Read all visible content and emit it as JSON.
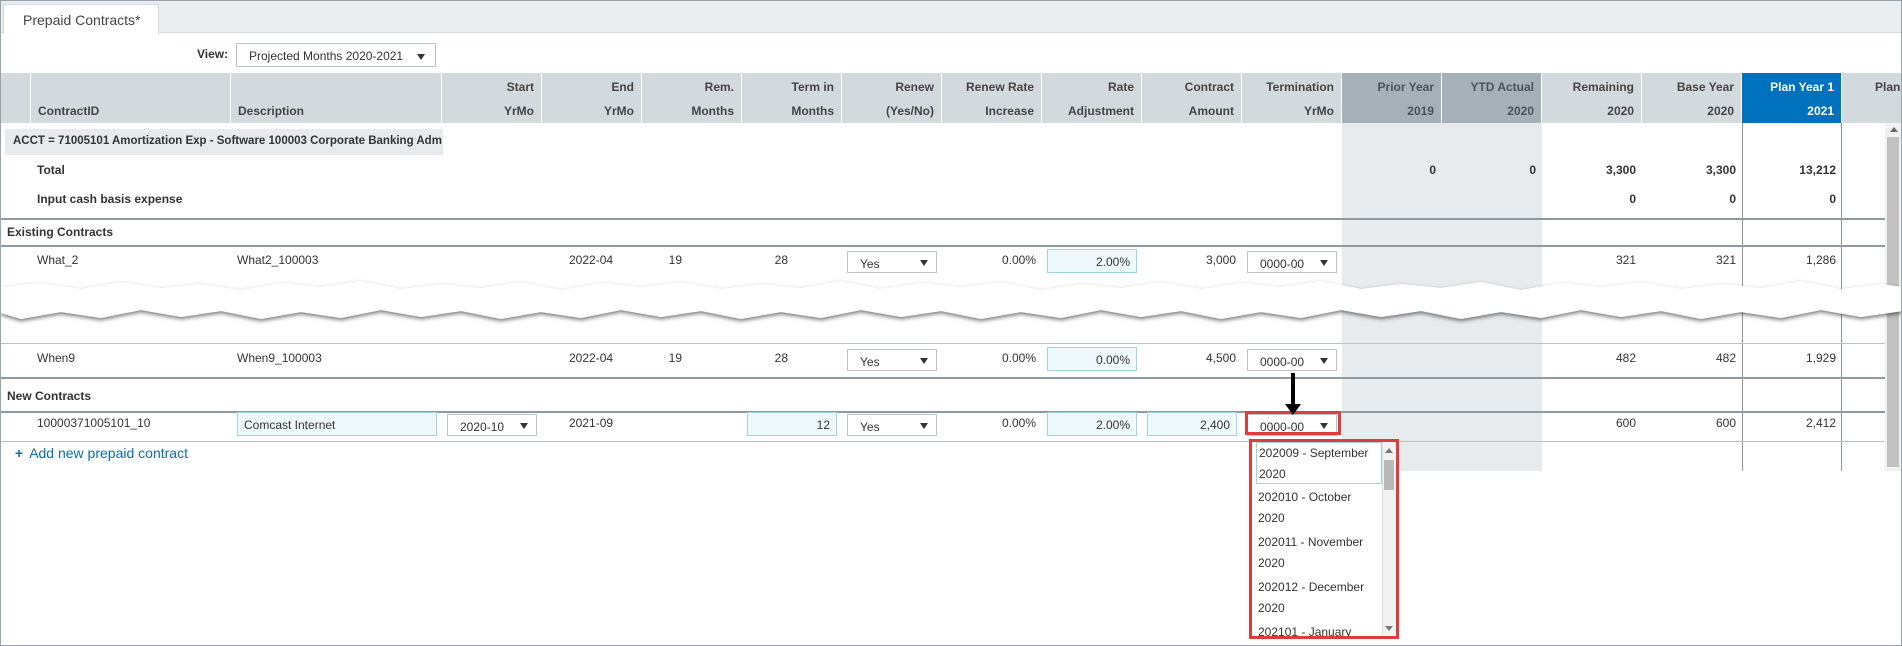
{
  "tab": {
    "label": "Prepaid Contracts*"
  },
  "view": {
    "label": "View:",
    "value": "Projected  Months 2020-2021"
  },
  "columns": [
    {
      "l1": "",
      "l2": "ContractID"
    },
    {
      "l1": "",
      "l2": "Description"
    },
    {
      "l1": "Start",
      "l2": "YrMo"
    },
    {
      "l1": "End",
      "l2": "YrMo"
    },
    {
      "l1": "Rem.",
      "l2": "Months"
    },
    {
      "l1": "Term in",
      "l2": "Months"
    },
    {
      "l1": "Renew",
      "l2": "(Yes/No)"
    },
    {
      "l1": "Renew Rate",
      "l2": "Increase"
    },
    {
      "l1": "Rate",
      "l2": "Adjustment"
    },
    {
      "l1": "Contract",
      "l2": "Amount"
    },
    {
      "l1": "Termination",
      "l2": "YrMo"
    },
    {
      "l1": "Prior Year",
      "l2": "2019"
    },
    {
      "l1": "YTD Actual",
      "l2": "2020"
    },
    {
      "l1": "Remaining",
      "l2": "2020"
    },
    {
      "l1": "Base Year",
      "l2": "2020"
    },
    {
      "l1": "Plan Year 1",
      "l2": "2021"
    },
    {
      "l1": "Plan",
      "l2": ""
    }
  ],
  "acct": "ACCT = 71005101 Amortization Exp - Software 100003 Corporate Banking Adm",
  "total": {
    "label": "Total",
    "prior": "0",
    "ytd": "0",
    "remaining": "3,300",
    "base": "3,300",
    "plan1": "13,212"
  },
  "input_cash": {
    "label": "Input cash basis expense",
    "remaining": "0",
    "base": "0",
    "plan1": "0"
  },
  "existing": {
    "label": "Existing Contracts",
    "rows": [
      {
        "id": "What_2",
        "desc": "What2_100003",
        "end": "2022-04",
        "rem": "19",
        "term": "28",
        "renew": "Yes",
        "renew_rate": "0.00%",
        "rate_adj": "2.00%",
        "amount": "3,000",
        "term_yrmo": "0000-00",
        "remaining": "321",
        "base": "321",
        "plan1": "1,286"
      },
      {
        "id": "When9",
        "desc": "When9_100003",
        "end": "2022-04",
        "rem": "19",
        "term": "28",
        "renew": "Yes",
        "renew_rate": "0.00%",
        "rate_adj": "0.00%",
        "amount": "4,500",
        "term_yrmo": "0000-00",
        "remaining": "482",
        "base": "482",
        "plan1": "1,929"
      }
    ]
  },
  "new_contracts": {
    "label": "New Contracts",
    "row": {
      "id": "10000371005101_10",
      "desc": "Comcast Internet",
      "start": "2020-10",
      "end": "2021-09",
      "term": "12",
      "renew": "Yes",
      "renew_rate": "0.00%",
      "rate_adj": "2.00%",
      "amount": "2,400",
      "term_yrmo": "0000-00",
      "remaining": "600",
      "base": "600",
      "plan1": "2,412"
    }
  },
  "add_link": "Add new prepaid contract",
  "dropdown_options": [
    {
      "l1": "202009 - September",
      "l2": "2020"
    },
    {
      "l1": "202010 - October",
      "l2": "2020"
    },
    {
      "l1": "202011 - November",
      "l2": "2020"
    },
    {
      "l1": "202012 - December",
      "l2": "2020"
    },
    {
      "l1": "202101 - January",
      "l2": ""
    }
  ],
  "colors": {
    "header": "#d3dade",
    "header_dark": "#a6b0b8",
    "header_blue": "#0071bc",
    "highlight": "#e23b3b",
    "input_bg": "#eef9fb",
    "link": "#0b6fb0"
  }
}
